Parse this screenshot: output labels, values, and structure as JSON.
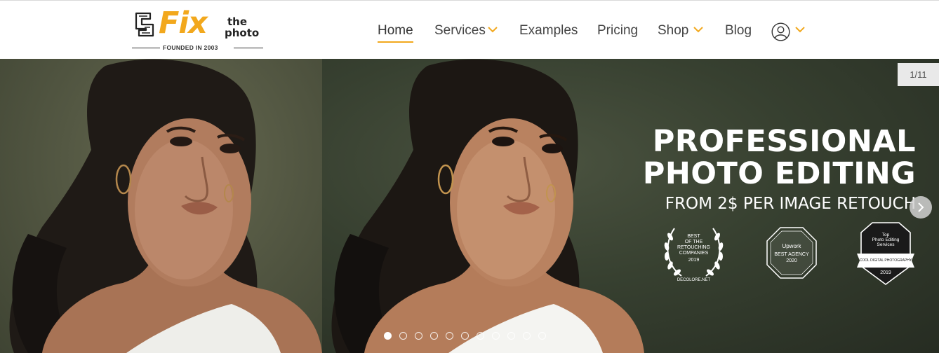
{
  "logo": {
    "word": "Fix",
    "the": "the",
    "photo": "photo",
    "tagline": "FOUNDED IN 2003",
    "accent": "#f2a81d"
  },
  "nav": {
    "items": [
      {
        "label": "Home",
        "active": true,
        "dropdown": false
      },
      {
        "label": "Services",
        "active": false,
        "dropdown": true
      },
      {
        "label": "Examples",
        "active": false,
        "dropdown": false
      },
      {
        "label": "Pricing",
        "active": false,
        "dropdown": false
      },
      {
        "label": "Shop",
        "active": false,
        "dropdown": true
      },
      {
        "label": "Blog",
        "active": false,
        "dropdown": false
      }
    ],
    "account_icon": "user-icon",
    "account_dropdown": "chevron-down-icon"
  },
  "hero": {
    "counter": "1/11",
    "headline_line1": "PROFESSIONAL",
    "headline_line2": "PHOTO EDITING",
    "subline": "FROM 2$ PER IMAGE RETOUCH",
    "badges": [
      {
        "line1": "BEST",
        "line2": "OF THE",
        "line3": "RETOUCHING",
        "line4": "COMPANIES",
        "year": "2019",
        "source": "DECOLORE.NET"
      },
      {
        "brand": "Upwork",
        "line1": "BEST AGENCY",
        "year": "2020"
      },
      {
        "line1": "Top",
        "line2": "Photo Editing",
        "line3": "Services",
        "brand": "COOL DIGITAL PHOTOGRAPHY",
        "year": "2019"
      }
    ],
    "slides_total": 11,
    "active_slide": 1
  }
}
